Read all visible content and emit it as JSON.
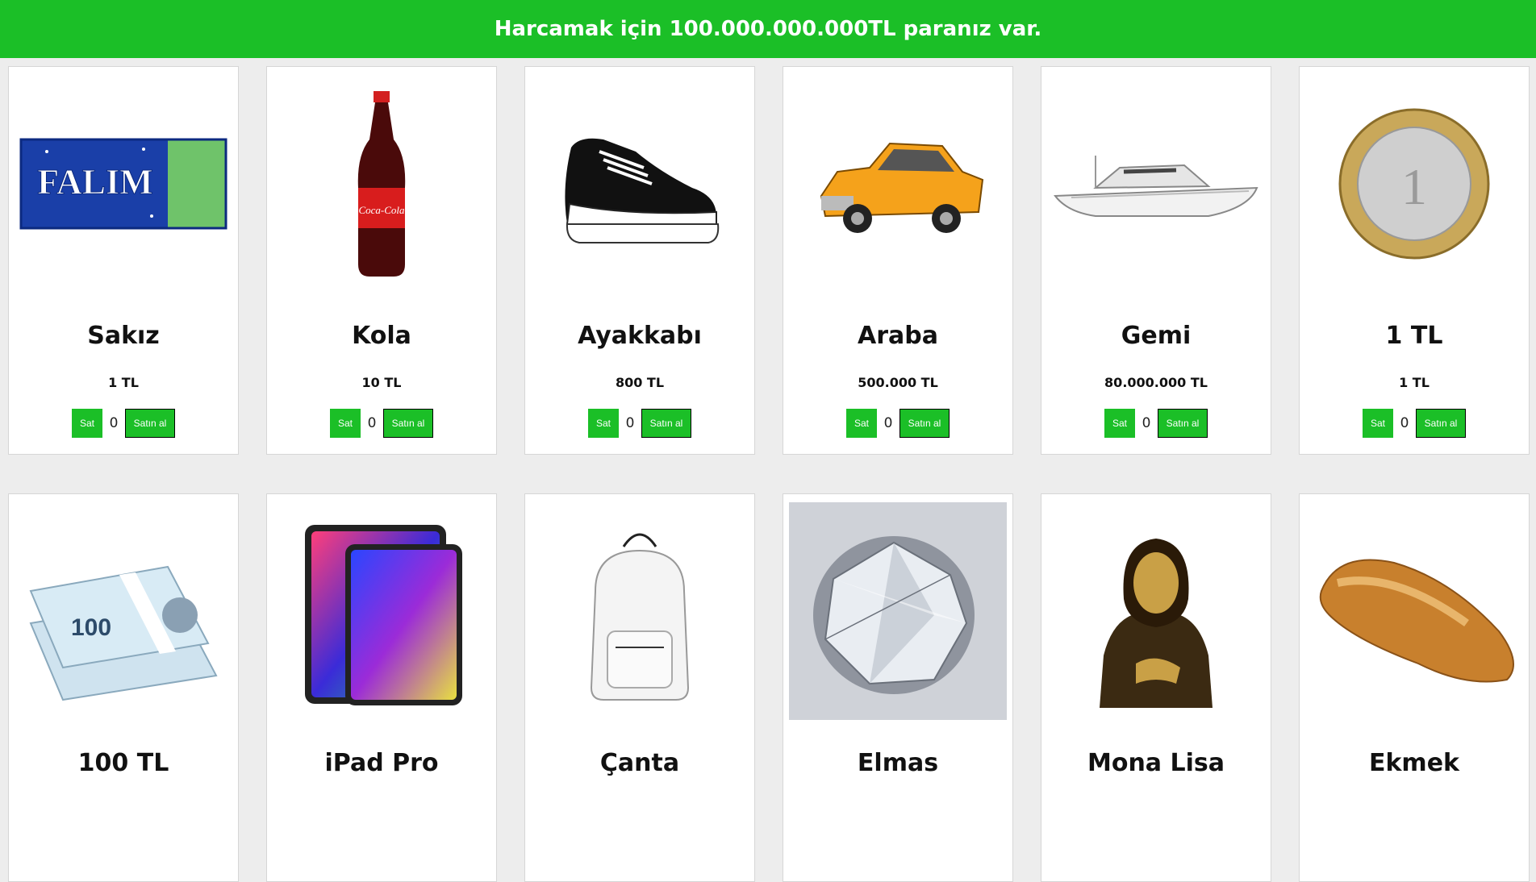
{
  "header": {
    "message": "Harcamak için 100.000.000.000TL paranız var."
  },
  "labels": {
    "sell": "Sat",
    "buy": "Satın al"
  },
  "products": [
    {
      "name": "Sakız",
      "price": "1 TL",
      "qty": "0",
      "icon": "gum-pack-icon",
      "brand": "FALIM"
    },
    {
      "name": "Kola",
      "price": "10 TL",
      "qty": "0",
      "icon": "cola-bottle-icon",
      "brand": "Coca-Cola"
    },
    {
      "name": "Ayakkabı",
      "price": "800 TL",
      "qty": "0",
      "icon": "sneaker-icon"
    },
    {
      "name": "Araba",
      "price": "500.000 TL",
      "qty": "0",
      "icon": "car-icon"
    },
    {
      "name": "Gemi",
      "price": "80.000.000 TL",
      "qty": "0",
      "icon": "yacht-icon"
    },
    {
      "name": "1 TL",
      "price": "1 TL",
      "qty": "0",
      "icon": "coin-icon"
    },
    {
      "name": "100 TL",
      "icon": "banknotes-icon"
    },
    {
      "name": "iPad Pro",
      "icon": "tablet-icon"
    },
    {
      "name": "Çanta",
      "icon": "backpack-icon"
    },
    {
      "name": "Elmas",
      "icon": "diamond-icon"
    },
    {
      "name": "Mona Lisa",
      "icon": "painting-icon"
    },
    {
      "name": "Ekmek",
      "icon": "bread-icon"
    }
  ],
  "colors": {
    "accent": "#1bbf27",
    "background": "#ededed"
  }
}
